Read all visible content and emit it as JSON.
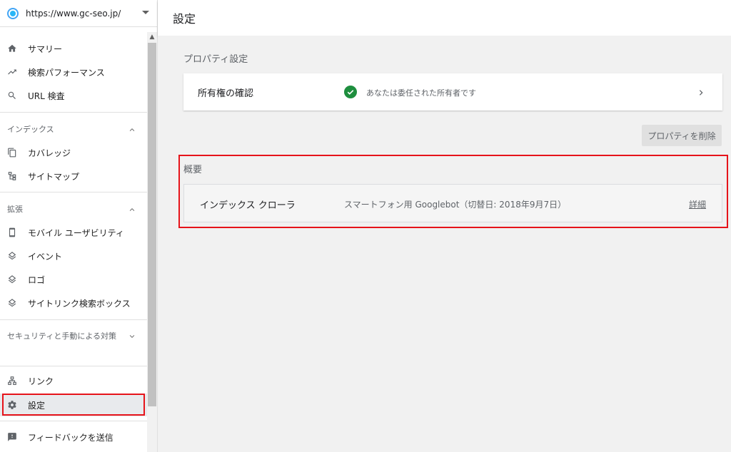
{
  "sidebar": {
    "property_url": "https://www.gc-seo.jp/",
    "items_top": [
      {
        "label": "サマリー",
        "icon": "home-icon"
      },
      {
        "label": "検索パフォーマンス",
        "icon": "trending-up-icon"
      },
      {
        "label": "URL 検査",
        "icon": "search-icon"
      }
    ],
    "index_header": "インデックス",
    "index_items": [
      {
        "label": "カバレッジ",
        "icon": "copy-icon"
      },
      {
        "label": "サイトマップ",
        "icon": "sitemap-icon"
      }
    ],
    "enhance_header": "拡張",
    "enhance_items": [
      {
        "label": "モバイル ユーザビリティ",
        "icon": "smartphone-icon"
      },
      {
        "label": "イベント",
        "icon": "layers-icon"
      },
      {
        "label": "ロゴ",
        "icon": "layers-icon"
      },
      {
        "label": "サイトリンク検索ボックス",
        "icon": "layers-icon"
      }
    ],
    "security_header": "セキュリティと手動による対策",
    "bottom_items": [
      {
        "label": "リンク",
        "icon": "links-icon"
      },
      {
        "label": "設定",
        "icon": "gear-icon",
        "active": true
      }
    ],
    "feedback_label": "フィードバックを送信"
  },
  "header": {
    "title": "設定"
  },
  "main": {
    "property_settings_title": "プロパティ設定",
    "ownership": {
      "title": "所有権の確認",
      "status": "あなたは委任された所有者です"
    },
    "delete_button": "プロパティを削除",
    "overview_title": "概要",
    "crawler": {
      "label": "インデックス クローラ",
      "value": "スマートフォン用 Googlebot（切替日: 2018年9月7日）",
      "detail_link": "詳細"
    }
  },
  "colors": {
    "highlight_box": "#e6131a",
    "check_green": "#1e8e3e",
    "property_icon": "#29b6f6"
  }
}
